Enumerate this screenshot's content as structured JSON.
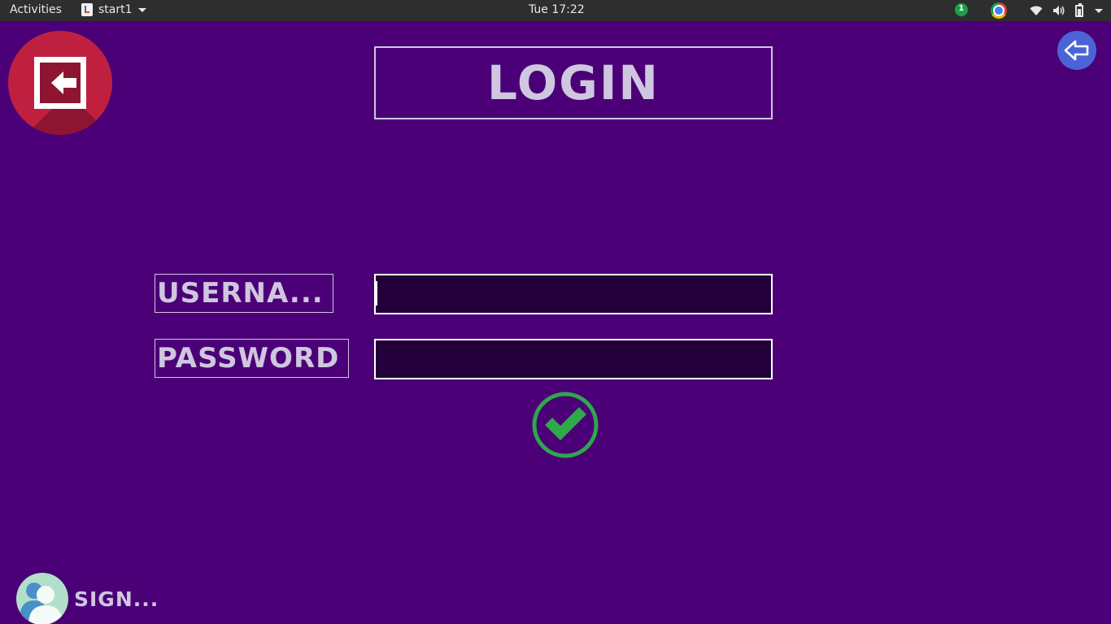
{
  "topbar": {
    "activities": "Activities",
    "app_name": "start1",
    "clock": "Tue 17:22",
    "notification_count": "1",
    "icons": [
      "java-icon",
      "chrome-icon",
      "wifi-icon",
      "volume-icon",
      "battery-icon",
      "system-menu-arrow"
    ]
  },
  "app": {
    "title": "LOGIN",
    "username_label": "USERNA...",
    "password_label": "PASSWORD",
    "username_value": "",
    "password_value": "",
    "signup_label": "SIGN...",
    "icons": {
      "exit": "exit-door-arrow-icon",
      "back": "back-arrow-icon",
      "confirm": "check-circle-icon",
      "signup": "user-avatar-icon"
    }
  },
  "colors": {
    "background": "#4b0078",
    "text": "#cfc6df",
    "input_background": "#23003a",
    "exit_button": "#c0203f",
    "back_button": "#4b63d6",
    "confirm": "#2ea84a"
  }
}
